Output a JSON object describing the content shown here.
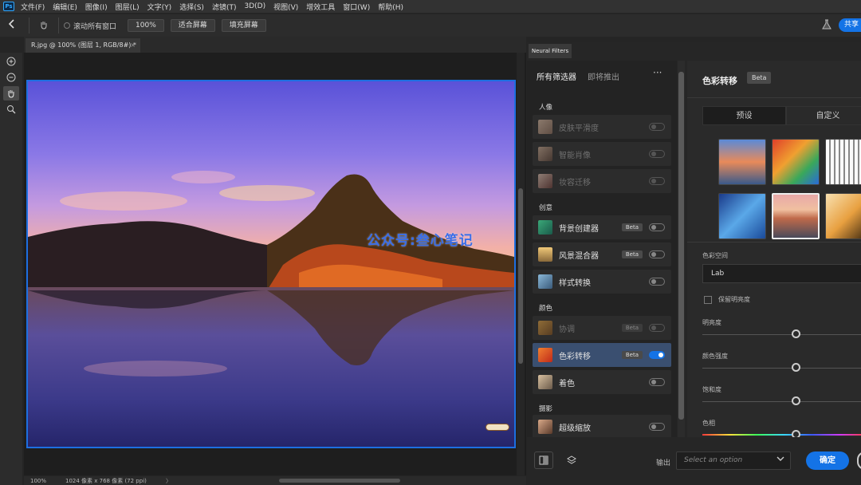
{
  "app": {
    "logo_text": "Ps",
    "menu": [
      "文件(F)",
      "编辑(E)",
      "图像(I)",
      "图层(L)",
      "文字(Y)",
      "选择(S)",
      "滤镜(T)",
      "3D(D)",
      "视图(V)",
      "增效工具",
      "窗口(W)",
      "帮助(H)"
    ]
  },
  "options_bar": {
    "scroll_all_windows": "滚动所有窗口",
    "zoom_button": "100%",
    "fit_screen": "适合屏幕",
    "fill_screen": "填充屏幕",
    "share": "共享"
  },
  "document": {
    "tab_title": "R.jpg @ 100% (图层 1, RGB/8#) *",
    "close_glyph": "×",
    "watermark": "公众号:叁心笔记"
  },
  "status_bar": {
    "zoom": "100%",
    "info": "1024 像素 x 768 像素 (72 ppi)",
    "chevron": "〉"
  },
  "neural_filters": {
    "panel_tab": "Neural Filters",
    "tabs": [
      {
        "label": "所有筛选器",
        "active": true
      },
      {
        "label": "即将推出",
        "active": false
      }
    ],
    "more_glyph": "···",
    "categories": [
      {
        "label": "人像",
        "filters": [
          {
            "name": "皮肤平滑度",
            "beta": false,
            "enabled": false,
            "disabled": true
          },
          {
            "name": "智能肖像",
            "beta": false,
            "enabled": false,
            "disabled": true
          },
          {
            "name": "妆容迁移",
            "beta": false,
            "enabled": false,
            "disabled": true
          }
        ]
      },
      {
        "label": "创意",
        "filters": [
          {
            "name": "背景创建器",
            "beta": true,
            "enabled": false,
            "disabled": false
          },
          {
            "name": "风景混合器",
            "beta": true,
            "enabled": false,
            "disabled": false
          },
          {
            "name": "样式转换",
            "beta": false,
            "enabled": false,
            "disabled": false
          }
        ]
      },
      {
        "label": "颜色",
        "filters": [
          {
            "name": "协调",
            "beta": true,
            "enabled": false,
            "disabled": true
          },
          {
            "name": "色彩转移",
            "beta": true,
            "enabled": true,
            "disabled": false,
            "selected": true
          },
          {
            "name": "着色",
            "beta": false,
            "enabled": false,
            "disabled": false
          }
        ]
      },
      {
        "label": "摄影",
        "filters": [
          {
            "name": "超级缩放",
            "beta": false,
            "enabled": false,
            "disabled": false
          }
        ]
      }
    ],
    "beta_label": "Beta",
    "detail": {
      "title": "色彩转移",
      "beta": "Beta",
      "segments": [
        "预设",
        "自定义"
      ],
      "color_space_label": "色彩空间",
      "color_space_value": "Lab",
      "preserve_luminosity": "保留明亮度",
      "sliders": [
        {
          "label": "明亮度",
          "value": 0.5
        },
        {
          "label": "颜色强度",
          "value": 0.5
        },
        {
          "label": "饱和度",
          "value": 0.5
        },
        {
          "label": "色相",
          "value": 0.5
        }
      ]
    },
    "output_label": "输出",
    "output_placeholder": "Select an option",
    "ok": "确定"
  },
  "colors": {
    "accent": "#1473e6",
    "selection_border": "#1d6fe0",
    "selected_row": "#3a4f70"
  }
}
